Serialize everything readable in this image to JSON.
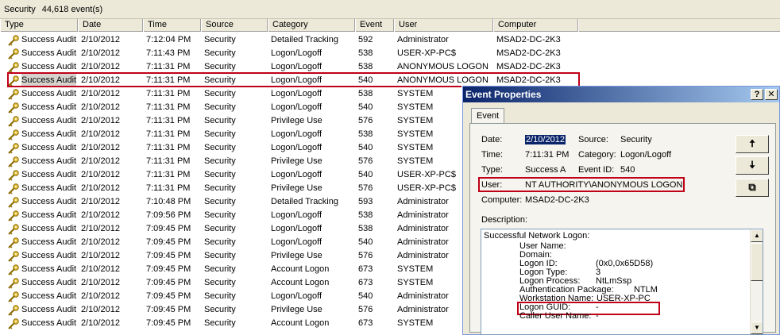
{
  "statusbar": {
    "title": "Security",
    "count": "44,618 event(s)"
  },
  "columns": [
    "Type",
    "Date",
    "Time",
    "Source",
    "Category",
    "Event",
    "User",
    "Computer"
  ],
  "rows": [
    [
      "Success Audit",
      "2/10/2012",
      "7:12:04 PM",
      "Security",
      "Detailed Tracking",
      "592",
      "Administrator",
      "MSAD2-DC-2K3"
    ],
    [
      "Success Audit",
      "2/10/2012",
      "7:11:43 PM",
      "Security",
      "Logon/Logoff",
      "538",
      "USER-XP-PC$",
      "MSAD2-DC-2K3"
    ],
    [
      "Success Audit",
      "2/10/2012",
      "7:11:31 PM",
      "Security",
      "Logon/Logoff",
      "538",
      "ANONYMOUS LOGON",
      "MSAD2-DC-2K3"
    ],
    [
      "Success Audit",
      "2/10/2012",
      "7:11:31 PM",
      "Security",
      "Logon/Logoff",
      "540",
      "ANONYMOUS LOGON",
      "MSAD2-DC-2K3"
    ],
    [
      "Success Audit",
      "2/10/2012",
      "7:11:31 PM",
      "Security",
      "Logon/Logoff",
      "538",
      "SYSTEM",
      ""
    ],
    [
      "Success Audit",
      "2/10/2012",
      "7:11:31 PM",
      "Security",
      "Logon/Logoff",
      "540",
      "SYSTEM",
      ""
    ],
    [
      "Success Audit",
      "2/10/2012",
      "7:11:31 PM",
      "Security",
      "Privilege Use",
      "576",
      "SYSTEM",
      ""
    ],
    [
      "Success Audit",
      "2/10/2012",
      "7:11:31 PM",
      "Security",
      "Logon/Logoff",
      "538",
      "SYSTEM",
      ""
    ],
    [
      "Success Audit",
      "2/10/2012",
      "7:11:31 PM",
      "Security",
      "Logon/Logoff",
      "540",
      "SYSTEM",
      ""
    ],
    [
      "Success Audit",
      "2/10/2012",
      "7:11:31 PM",
      "Security",
      "Privilege Use",
      "576",
      "SYSTEM",
      ""
    ],
    [
      "Success Audit",
      "2/10/2012",
      "7:11:31 PM",
      "Security",
      "Logon/Logoff",
      "540",
      "USER-XP-PC$",
      ""
    ],
    [
      "Success Audit",
      "2/10/2012",
      "7:11:31 PM",
      "Security",
      "Privilege Use",
      "576",
      "USER-XP-PC$",
      ""
    ],
    [
      "Success Audit",
      "2/10/2012",
      "7:10:48 PM",
      "Security",
      "Detailed Tracking",
      "593",
      "Administrator",
      ""
    ],
    [
      "Success Audit",
      "2/10/2012",
      "7:09:56 PM",
      "Security",
      "Logon/Logoff",
      "538",
      "Administrator",
      ""
    ],
    [
      "Success Audit",
      "2/10/2012",
      "7:09:45 PM",
      "Security",
      "Logon/Logoff",
      "538",
      "Administrator",
      ""
    ],
    [
      "Success Audit",
      "2/10/2012",
      "7:09:45 PM",
      "Security",
      "Logon/Logoff",
      "540",
      "Administrator",
      ""
    ],
    [
      "Success Audit",
      "2/10/2012",
      "7:09:45 PM",
      "Security",
      "Privilege Use",
      "576",
      "Administrator",
      ""
    ],
    [
      "Success Audit",
      "2/10/2012",
      "7:09:45 PM",
      "Security",
      "Account Logon",
      "673",
      "SYSTEM",
      ""
    ],
    [
      "Success Audit",
      "2/10/2012",
      "7:09:45 PM",
      "Security",
      "Account Logon",
      "673",
      "SYSTEM",
      ""
    ],
    [
      "Success Audit",
      "2/10/2012",
      "7:09:45 PM",
      "Security",
      "Logon/Logoff",
      "540",
      "Administrator",
      ""
    ],
    [
      "Success Audit",
      "2/10/2012",
      "7:09:45 PM",
      "Security",
      "Privilege Use",
      "576",
      "Administrator",
      ""
    ],
    [
      "Success Audit",
      "2/10/2012",
      "7:09:45 PM",
      "Security",
      "Account Logon",
      "673",
      "SYSTEM",
      ""
    ]
  ],
  "dialog": {
    "title": "Event Properties",
    "help_label": "?",
    "close_label": "✕",
    "tab_label": "Event",
    "date_label": "Date:",
    "date_value": "2/10/2012",
    "source_label": "Source:",
    "source_value": "Security",
    "time_label": "Time:",
    "time_value": "7:11:31 PM",
    "category_label": "Category:",
    "category_value": "Logon/Logoff",
    "type_label": "Type:",
    "type_value": "Success A",
    "eventid_label": "Event ID:",
    "eventid_value": "540",
    "user_label": "User:",
    "user_value": "NT AUTHORITY\\ANONYMOUS LOGON",
    "computer_label": "Computer:",
    "computer_value": "MSAD2-DC-2K3",
    "up_glyph": "🠅",
    "down_glyph": "🠇",
    "copy_glyph": "⧉",
    "description_label": "Description:",
    "description": {
      "heading": "Successful Network Logon:",
      "fields": [
        [
          "User Name:",
          ""
        ],
        [
          "Domain:",
          ""
        ],
        [
          "Logon ID:",
          "(0x0,0x65D58)"
        ],
        [
          "Logon Type:",
          "3"
        ],
        [
          "Logon Process:",
          "NtLmSsp"
        ],
        [
          "Authentication Package:",
          "NTLM"
        ],
        [
          "Workstation Name:",
          "USER-XP-PC"
        ],
        [
          "Logon GUID:",
          "-"
        ],
        [
          "Caller User Name:",
          "-"
        ]
      ]
    }
  }
}
